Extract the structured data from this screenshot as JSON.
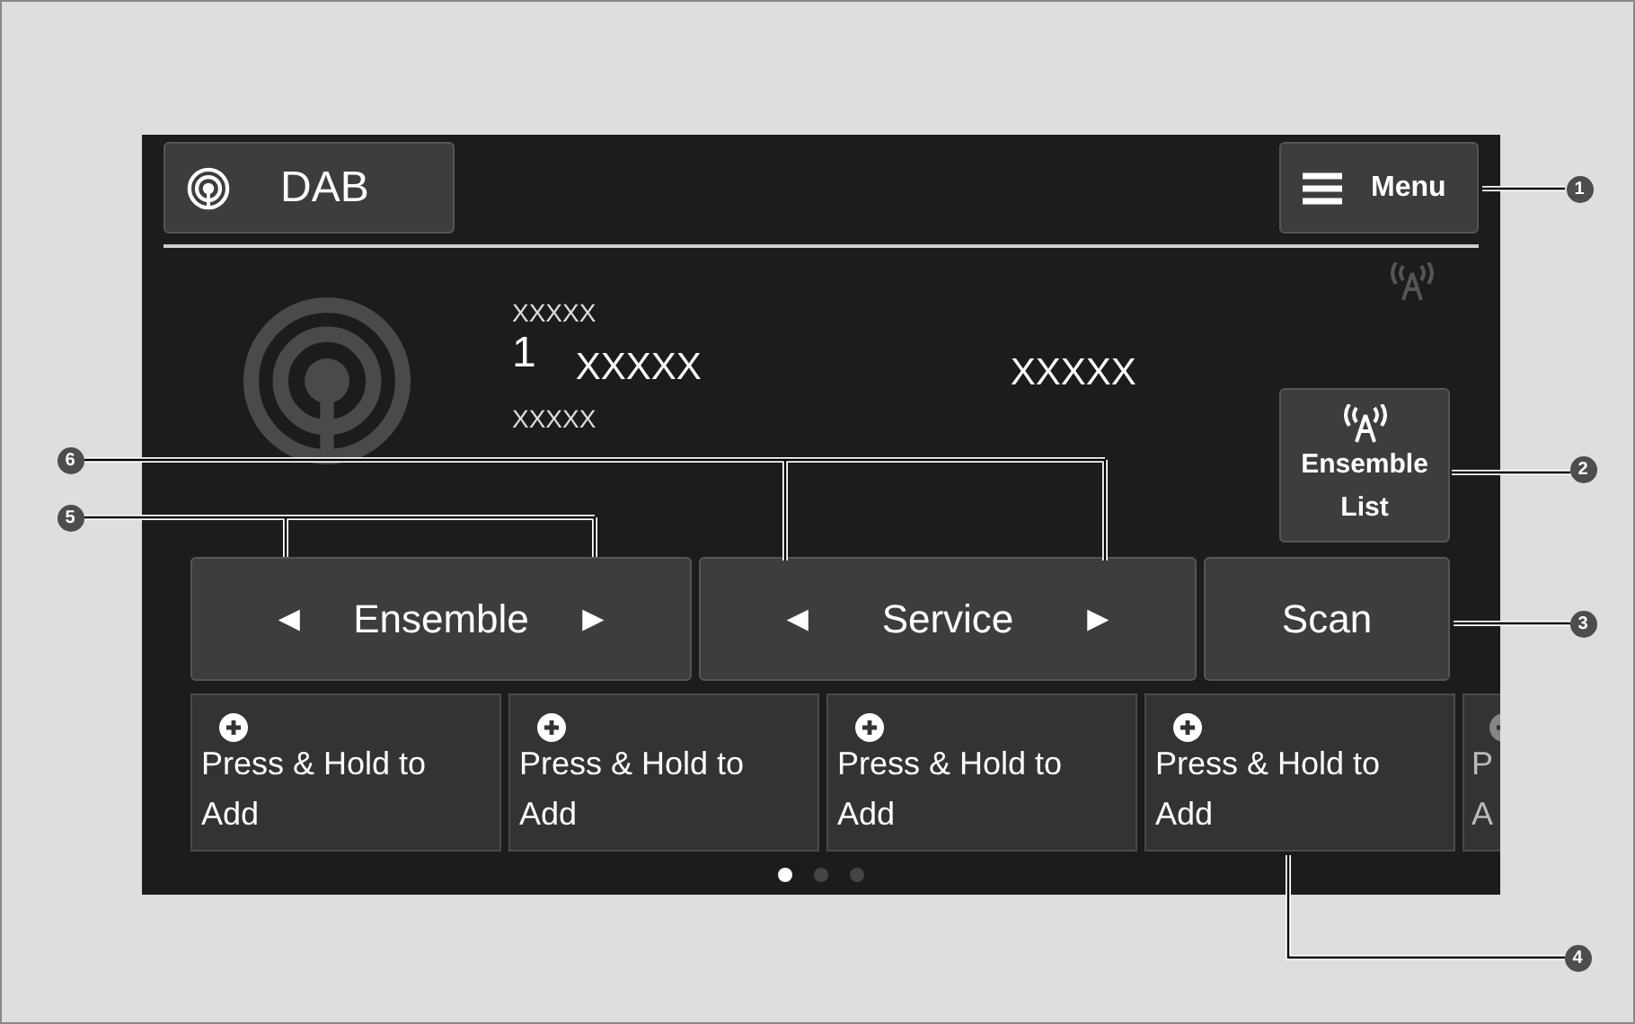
{
  "source_button": {
    "label": "DAB"
  },
  "menu_button": {
    "label": "Menu"
  },
  "station": {
    "top": "XXXXX",
    "number": "1",
    "name": "XXXXX",
    "bottom": "XXXXX",
    "right": "XXXXX"
  },
  "ensemble_list_button": {
    "label": "Ensemble List"
  },
  "controls": [
    {
      "kind": "stepper",
      "label": "Ensemble",
      "prev": "◄",
      "next": "►"
    },
    {
      "kind": "stepper",
      "label": "Service",
      "prev": "◄",
      "next": "►"
    },
    {
      "kind": "button",
      "label": "Scan"
    }
  ],
  "presets": [
    {
      "label": "Press & Hold to Add",
      "partial": false
    },
    {
      "label": "Press & Hold to Add",
      "partial": false
    },
    {
      "label": "Press & Hold to Add",
      "partial": false
    },
    {
      "label": "Press & Hold to Add",
      "partial": false
    },
    {
      "label": "P A",
      "partial": true
    }
  ],
  "pages": [
    {
      "selected": true
    },
    {
      "selected": false
    },
    {
      "selected": false
    }
  ],
  "callouts": [
    {
      "number": "1"
    },
    {
      "number": "6"
    },
    {
      "number": "2"
    },
    {
      "number": "5"
    },
    {
      "number": "3"
    },
    {
      "number": "4"
    }
  ]
}
